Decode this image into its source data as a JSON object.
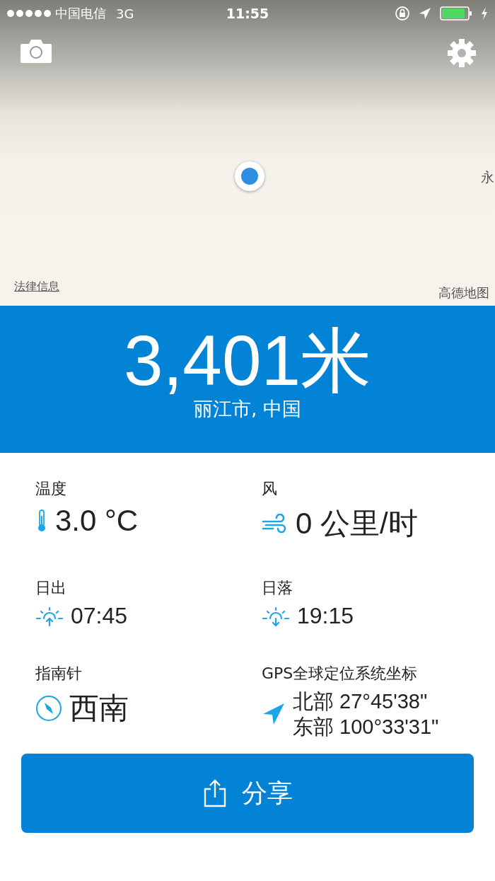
{
  "status_bar": {
    "carrier": "中国电信",
    "network": "3G",
    "time": "11:55"
  },
  "map": {
    "legal_link": "法律信息",
    "provider": "高德地图",
    "edge_label": "永"
  },
  "altitude": {
    "value": "3,401米",
    "place": "丽江市, 中国"
  },
  "stats": [
    {
      "kind": "thermometer",
      "label": "温度",
      "lines": [
        "3.0 °C"
      ]
    },
    {
      "kind": "wind",
      "label": "风",
      "lines": [
        "0 公里/时"
      ]
    },
    {
      "kind": "sunrise",
      "label": "日出",
      "lines": [
        "07:45"
      ]
    },
    {
      "kind": "sunset",
      "label": "日落",
      "lines": [
        "19:15"
      ]
    },
    {
      "kind": "compass",
      "label": "指南针",
      "lines": [
        "西南"
      ]
    },
    {
      "kind": "location",
      "label": "GPS全球定位系统坐标",
      "lines": [
        "北部 27°45'38\"",
        "东部 100°33'31\""
      ]
    }
  ],
  "share_button": {
    "label": "分享"
  }
}
